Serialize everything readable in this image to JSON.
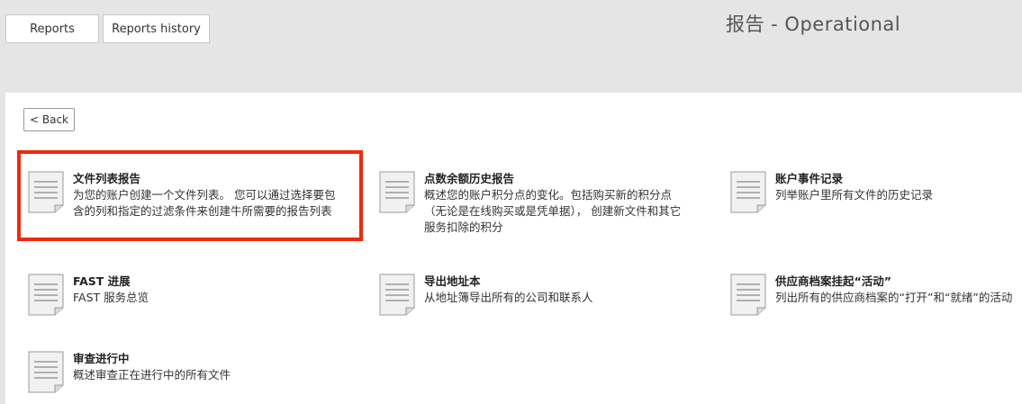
{
  "header": {
    "tabs": [
      {
        "label": "Reports"
      },
      {
        "label": "Reports history"
      }
    ],
    "title": "报告 - Operational"
  },
  "content": {
    "back_label": "< Back",
    "reports": [
      {
        "title": "文件列表报告",
        "desc_lines": [
          "为您的账户创建一个文件列表。 您可以通过选择要包",
          "含的列和指定的过滤条件来创建牛所需要的报告列表"
        ]
      },
      {
        "title": "点数余额历史报告",
        "desc_lines": [
          "概述您的账户积分点的变化。包括购买新的积分点",
          "（无论是在线购买或是凭单据）， 创建新文件和其它",
          "服务扣除的积分"
        ]
      },
      {
        "title": "账户事件记录",
        "desc_lines": [
          "列举账户里所有文件的历史记录"
        ]
      },
      {
        "title": "FAST 进展",
        "desc_lines": [
          "FAST 服务总览"
        ]
      },
      {
        "title": "导出地址本",
        "desc_lines": [
          "从地址簿导出所有的公司和联系人"
        ]
      },
      {
        "title": "供应商档案挂起“活动”",
        "desc_lines": [
          "列出所有的供应商档案的“打开”和“就绪”的活动"
        ]
      },
      {
        "title": "审查进行中",
        "desc_lines": [
          "概述审查正在进行中的所有文件"
        ]
      }
    ],
    "highlight_color": "#ee2a0b",
    "icon": "document-icon"
  }
}
